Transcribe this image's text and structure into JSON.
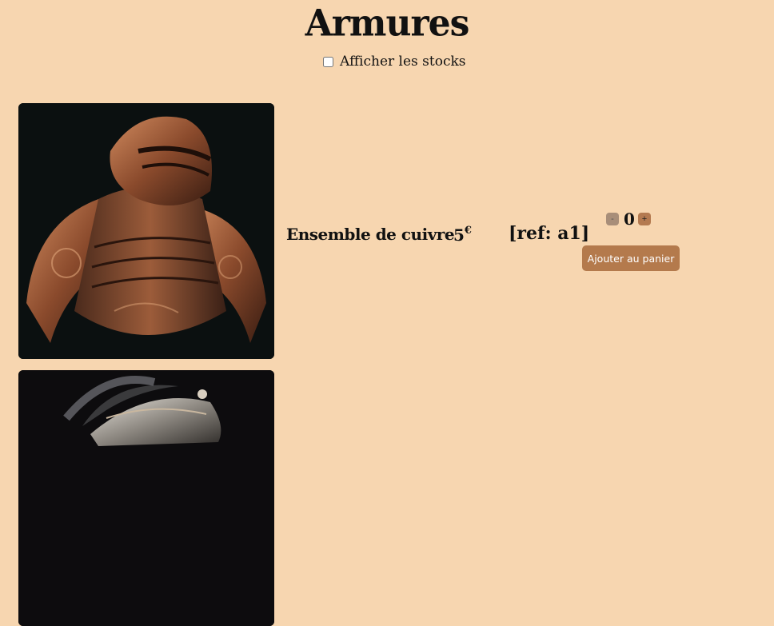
{
  "page": {
    "title": "Armures"
  },
  "filters": {
    "show_stock_label": "Afficher les stocks",
    "show_stock_checked": false
  },
  "products": [
    {
      "name": "Ensemble de cuivre",
      "price": "5",
      "currency": "€",
      "ref": "[ref: a1]",
      "quantity": "0",
      "minus_label": "-",
      "plus_label": "+",
      "add_to_cart_label": "Ajouter au panier",
      "image": "copper-armor-image"
    },
    {
      "image": "silver-helmet-image"
    }
  ],
  "colors": {
    "background": "#f7d6b0",
    "accent_button": "#b47a4c",
    "minus_button": "#a88e79"
  }
}
